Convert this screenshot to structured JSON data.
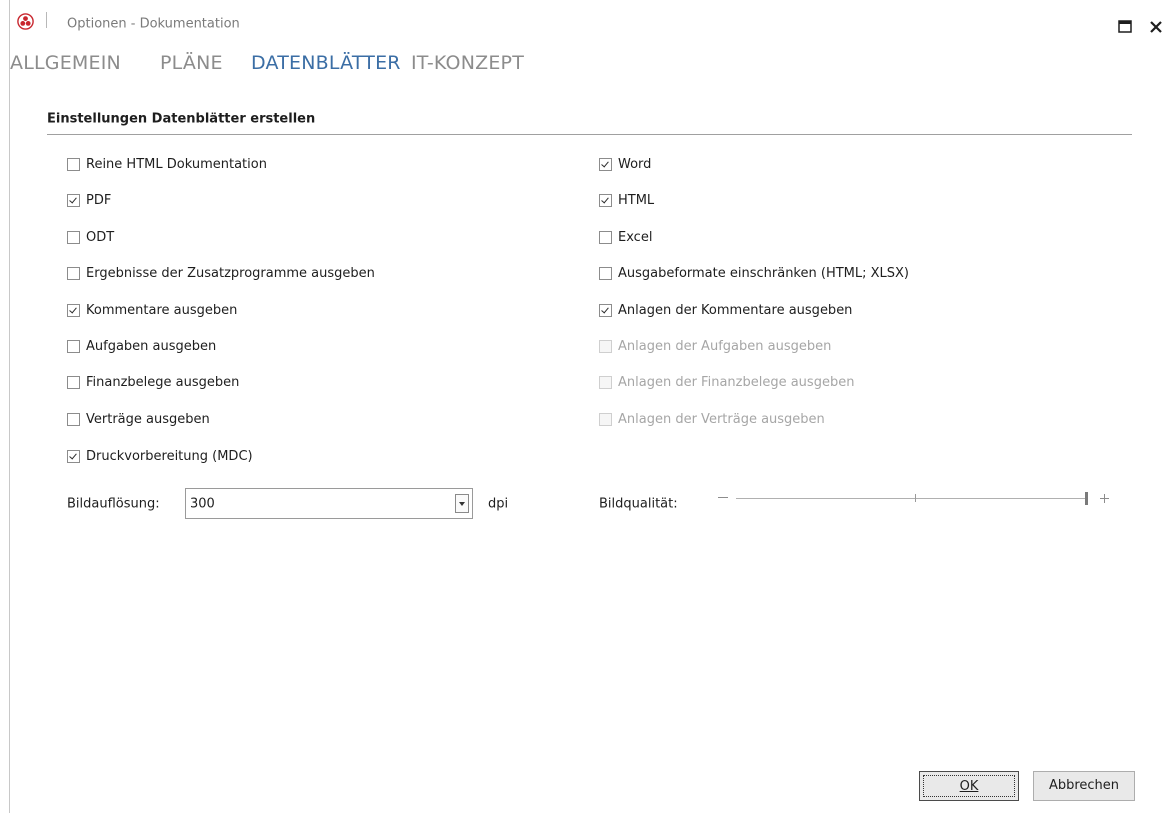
{
  "window": {
    "title": "Optionen - Dokumentation",
    "logo_icon": "red-trefoil-logo-icon",
    "maximize_icon": "maximize-icon",
    "close_icon": "close-icon"
  },
  "tabs": [
    {
      "label": "ALLGEMEIN",
      "active": false
    },
    {
      "label": "PLÄNE",
      "active": false
    },
    {
      "label": "DATENBLÄTTER",
      "active": true
    },
    {
      "label": "IT-KONZEPT",
      "active": false
    }
  ],
  "section": {
    "title": "Einstellungen Datenblätter erstellen"
  },
  "options_left": [
    {
      "label": "Reine HTML Dokumentation",
      "checked": false,
      "enabled": true
    },
    {
      "label": "PDF",
      "checked": true,
      "enabled": true
    },
    {
      "label": "ODT",
      "checked": false,
      "enabled": true
    },
    {
      "label": "Ergebnisse der Zusatzprogramme ausgeben",
      "checked": false,
      "enabled": true
    },
    {
      "label": "Kommentare ausgeben",
      "checked": true,
      "enabled": true
    },
    {
      "label": "Aufgaben ausgeben",
      "checked": false,
      "enabled": true
    },
    {
      "label": "Finanzbelege ausgeben",
      "checked": false,
      "enabled": true
    },
    {
      "label": "Verträge ausgeben",
      "checked": false,
      "enabled": true
    },
    {
      "label": "Druckvorbereitung (MDC)",
      "checked": true,
      "enabled": true
    }
  ],
  "options_right": [
    {
      "label": "Word",
      "checked": true,
      "enabled": true
    },
    {
      "label": "HTML",
      "checked": true,
      "enabled": true
    },
    {
      "label": "Excel",
      "checked": false,
      "enabled": true
    },
    {
      "label": "Ausgabeformate einschränken (HTML; XLSX)",
      "checked": false,
      "enabled": true
    },
    {
      "label": "Anlagen der Kommentare ausgeben",
      "checked": true,
      "enabled": true
    },
    {
      "label": "Anlagen der Aufgaben ausgeben",
      "checked": false,
      "enabled": false
    },
    {
      "label": "Anlagen der Finanzbelege ausgeben",
      "checked": false,
      "enabled": false
    },
    {
      "label": "Anlagen der Verträge ausgeben",
      "checked": false,
      "enabled": false
    }
  ],
  "resolution": {
    "label": "Bildauflösung:",
    "value": "300",
    "unit": "dpi"
  },
  "quality": {
    "label": "Bildqualität:",
    "level": 1.0
  },
  "buttons": {
    "ok": "OK",
    "cancel": "Abbrechen"
  }
}
